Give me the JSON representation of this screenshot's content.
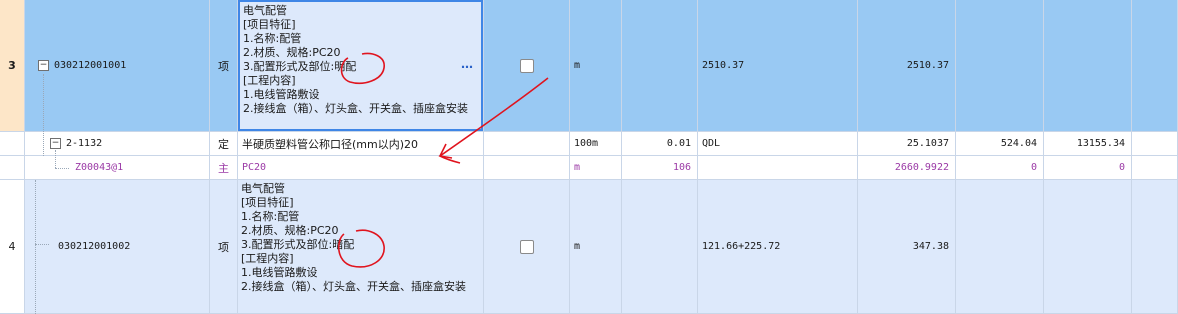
{
  "rows": [
    {
      "index": "3",
      "code": "030212001001",
      "type": "项",
      "description": "电气配管\n[项目特征]\n1.名称:配管\n2.材质、规格:PC20\n3.配置形式及部位:明配\n[工程内容]\n1.电线管路敷设\n2.接线盒（箱）、灯头盒、开关盒、插座盒安装",
      "more_icon": "⋯",
      "unit": "m",
      "expression": "2510.37",
      "quantity": "2510.37"
    },
    {
      "code": "2-1132",
      "type": "定",
      "description": "半硬质塑料管公称口径(mm以内)20",
      "unit": "100m",
      "coef": "0.01",
      "expression": "QDL",
      "quantity": "25.1037",
      "price": "524.04",
      "total": "13155.34"
    },
    {
      "code": "Z00043@1",
      "type": "主",
      "description": "PC20",
      "unit": "m",
      "coef": "106",
      "quantity": "2660.9922",
      "price": "0",
      "total": "0"
    },
    {
      "index": "4",
      "code": "030212001002",
      "type": "项",
      "description": "电气配管\n[项目特征]\n1.名称:配管\n2.材质、规格:PC20\n3.配置形式及部位:暗配\n[工程内容]\n1.电线管路敷设\n2.接线盒（箱）、灯头盒、开关盒、插座盒安装",
      "unit": "m",
      "expression": "121.66+225.72",
      "quantity": "347.38"
    }
  ],
  "collapse_symbol": "−",
  "colors": {
    "selected_row": "#99c9f3",
    "light_row": "#dde9fb",
    "index_cell": "#fde6c8",
    "material_text": "#9b3aa6",
    "annotation_red": "#e0141e",
    "focus_border": "#3f86e6"
  }
}
